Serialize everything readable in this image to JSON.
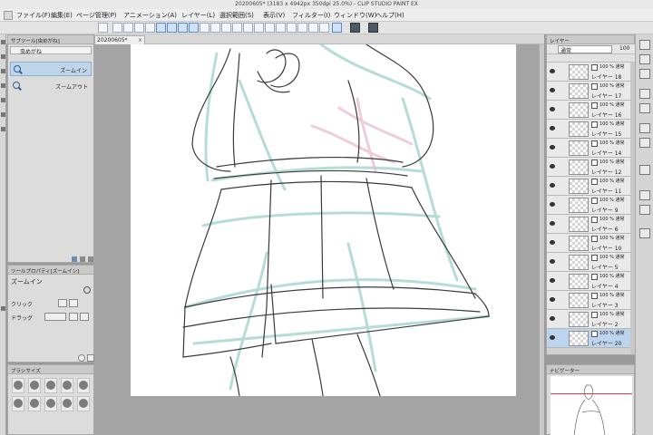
{
  "window": {
    "title": "20200605* (3183 x 4942px 350dpi 25.0%) - CLIP STUDIO PAINT EX"
  },
  "menu": {
    "items": [
      "ファイル(F)",
      "編集(E)",
      "ページ管理(P)",
      "アニメーション(A)",
      "レイヤー(L)",
      "選択範囲(S)",
      "表示(V)",
      "フィルター(I)",
      "ウィンドウ(W)",
      "ヘルプ(H)"
    ]
  },
  "document_tab": {
    "label": "20200605*",
    "close_glyph": "×"
  },
  "subtool_panel": {
    "header": "サブツール[虫めがね]",
    "group_label": "虫めがね",
    "items": [
      {
        "label": "ズームイン",
        "selected": true
      },
      {
        "label": "ズームアウト",
        "selected": false
      }
    ]
  },
  "tool_property": {
    "header": "ツールプロパティ[ズームイン]",
    "tool_name": "ズームイン",
    "click_label": "クリック",
    "drag_label": "ドラッグ"
  },
  "brush_size": {
    "header": "ブラシサイズ"
  },
  "layer_panel": {
    "header": "レイヤー",
    "blend_mode": "通常",
    "opacity": "100",
    "layers": [
      {
        "mode": "100 % 通常",
        "name": "レイヤー 18",
        "selected": false
      },
      {
        "mode": "100 % 通常",
        "name": "レイヤー 17",
        "selected": false
      },
      {
        "mode": "100 % 通常",
        "name": "レイヤー 16",
        "selected": false
      },
      {
        "mode": "100 % 通常",
        "name": "レイヤー 15",
        "selected": false
      },
      {
        "mode": "100 % 通常",
        "name": "レイヤー 14",
        "selected": false
      },
      {
        "mode": "100 % 通常",
        "name": "レイヤー 12",
        "selected": false
      },
      {
        "mode": "100 % 通常",
        "name": "レイヤー 11",
        "selected": false
      },
      {
        "mode": "100 % 通常",
        "name": "レイヤー 9",
        "selected": false
      },
      {
        "mode": "100 % 通常",
        "name": "レイヤー 6",
        "selected": false
      },
      {
        "mode": "100 % 通常",
        "name": "レイヤー 10",
        "selected": false
      },
      {
        "mode": "100 % 通常",
        "name": "レイヤー 5",
        "selected": false
      },
      {
        "mode": "100 % 通常",
        "name": "レイヤー 4",
        "selected": false
      },
      {
        "mode": "100 % 通常",
        "name": "レイヤー 3",
        "selected": false
      },
      {
        "mode": "100 % 通常",
        "name": "レイヤー 2",
        "selected": false
      },
      {
        "mode": "100 % 通常",
        "name": "レイヤー 20",
        "selected": true
      }
    ]
  },
  "navigator": {
    "header": "ナビゲーター"
  },
  "colors": {
    "selection": "#bcd4ee",
    "navigator_line": "#e83a3a",
    "sketch_dark": "#3a3a3a",
    "sketch_mint": "#a9d8cf",
    "sketch_pink": "#e9b8c8"
  },
  "icons": {
    "zoom_tool": "magnifier-icon",
    "layer_visibility": "eye-icon",
    "close": "close-icon"
  }
}
